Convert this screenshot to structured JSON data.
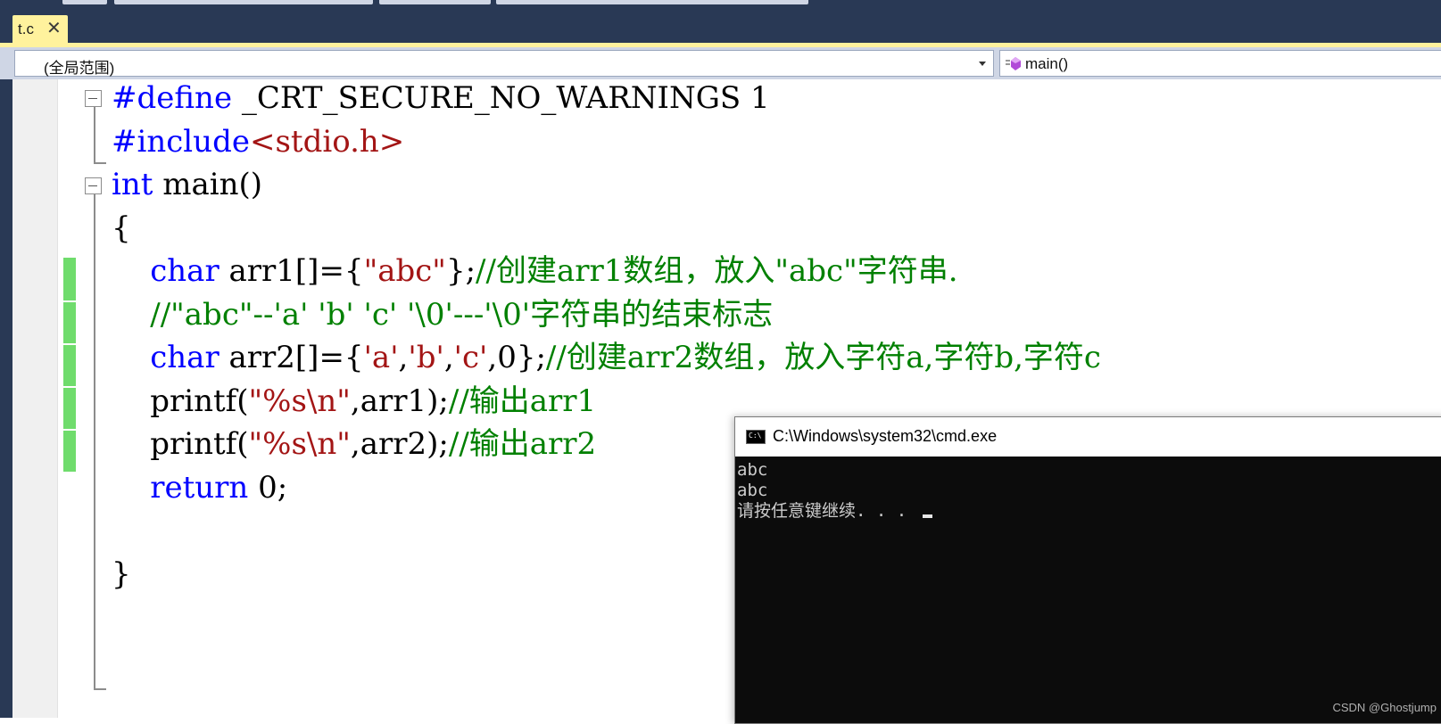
{
  "tab": {
    "filename": "t.c",
    "close_glyph": "✕"
  },
  "navbar": {
    "scope": "(全局范围)",
    "function": "main()"
  },
  "code_lines": [
    {
      "parts": [
        {
          "c": "pp",
          "t": "#define"
        },
        {
          "c": "",
          "t": " _CRT_SECURE_NO_WARNINGS 1"
        }
      ]
    },
    {
      "parts": [
        {
          "c": "pp",
          "t": "#include"
        },
        {
          "c": "str",
          "t": "<stdio.h>"
        }
      ]
    },
    {
      "parts": [
        {
          "c": "kw",
          "t": "int"
        },
        {
          "c": "",
          "t": " main()"
        }
      ]
    },
    {
      "parts": [
        {
          "c": "",
          "t": "{"
        }
      ]
    },
    {
      "parts": [
        {
          "c": "",
          "t": "    "
        },
        {
          "c": "kw",
          "t": "char"
        },
        {
          "c": "",
          "t": " arr1[]={"
        },
        {
          "c": "str",
          "t": "\"abc\""
        },
        {
          "c": "",
          "t": "};"
        },
        {
          "c": "cm",
          "t": "//创建arr1数组，放入\"abc\"字符串."
        }
      ]
    },
    {
      "parts": [
        {
          "c": "",
          "t": "    "
        },
        {
          "c": "cm",
          "t": "//\"abc\"--'a' 'b' 'c' '\\0'---'\\0'字符串的结束标志"
        }
      ]
    },
    {
      "parts": [
        {
          "c": "",
          "t": "    "
        },
        {
          "c": "kw",
          "t": "char"
        },
        {
          "c": "",
          "t": " arr2[]={"
        },
        {
          "c": "str",
          "t": "'a'"
        },
        {
          "c": "",
          "t": ","
        },
        {
          "c": "str",
          "t": "'b'"
        },
        {
          "c": "",
          "t": ","
        },
        {
          "c": "str",
          "t": "'c'"
        },
        {
          "c": "",
          "t": ",0};"
        },
        {
          "c": "cm",
          "t": "//创建arr2数组，放入字符a,字符b,字符c"
        }
      ]
    },
    {
      "parts": [
        {
          "c": "",
          "t": "    printf("
        },
        {
          "c": "str",
          "t": "\"%s\\n\""
        },
        {
          "c": "",
          "t": ",arr1);"
        },
        {
          "c": "cm",
          "t": "//输出arr1"
        }
      ]
    },
    {
      "parts": [
        {
          "c": "",
          "t": "    printf("
        },
        {
          "c": "str",
          "t": "\"%s\\n\""
        },
        {
          "c": "",
          "t": ",arr2);"
        },
        {
          "c": "cm",
          "t": "//输出arr2"
        }
      ]
    },
    {
      "parts": [
        {
          "c": "",
          "t": "    "
        },
        {
          "c": "kw",
          "t": "return"
        },
        {
          "c": "",
          "t": " 0;"
        }
      ]
    },
    {
      "parts": [
        {
          "c": "",
          "t": ""
        }
      ]
    },
    {
      "parts": [
        {
          "c": "",
          "t": "}"
        }
      ]
    }
  ],
  "console": {
    "title": "C:\\Windows\\system32\\cmd.exe",
    "icon_text": "C:\\",
    "lines": [
      "abc",
      "abc",
      "请按任意键继续. . . "
    ]
  },
  "watermark": "CSDN @Ghostjump",
  "colors": {
    "keyword": "#0000ff",
    "string": "#a31515",
    "comment": "#008000",
    "tab": "#fff29d",
    "frame": "#293955",
    "change_bar": "#6fdc6c"
  }
}
